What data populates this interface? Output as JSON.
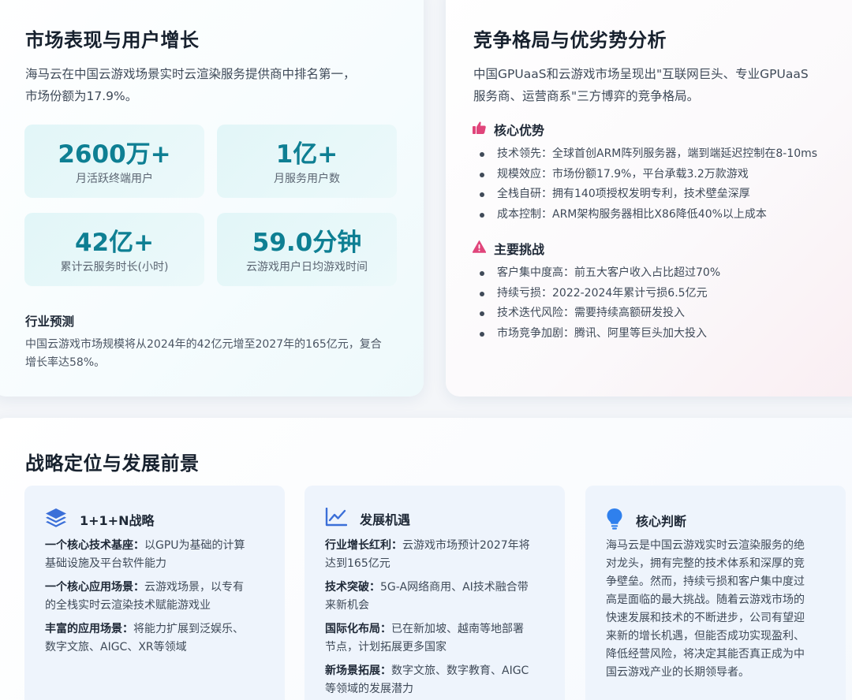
{
  "market": {
    "title": "市场表现与用户增长",
    "intro_line1": "海马云在中国云游戏场景实时云渲染服务提供商中排名第一，",
    "intro_line2": "市场份额为17.9%。",
    "stats": [
      {
        "value": "2600万+",
        "label": "月活跃终端用户"
      },
      {
        "value": "1亿+",
        "label": "月服务用户数"
      },
      {
        "value": "42亿+",
        "label": "累计云服务时长(小时)"
      },
      {
        "value": "59.0分钟",
        "label": "云游戏用户日均游戏时间"
      }
    ],
    "forecast_title": "行业预测",
    "forecast_line1": "中国云游戏市场规模将从2024年的42亿元增至2027年的165亿元，复合",
    "forecast_line2": "增长率达58%。"
  },
  "competition": {
    "title": "竞争格局与优劣势分析",
    "intro_line1": "中国GPUaaS和云游戏市场呈现出\"互联网巨头、专业GPUaaS",
    "intro_line2": "服务商、运营商系\"三方博弈的竞争格局。",
    "strengths_title": "核心优势",
    "strengths": [
      "技术领先：全球首创ARM阵列服务器，端到端延迟控制在8-10ms",
      "规模效应：市场份额17.9%，平台承载3.2万款游戏",
      "全栈自研：拥有140项授权发明专利，技术壁垒深厚",
      "成本控制：ARM架构服务器相比X86降低40%以上成本"
    ],
    "challenges_title": "主要挑战",
    "challenges": [
      "客户集中度高：前五大客户收入占比超过70%",
      "持续亏损：2022-2024年累计亏损6.5亿元",
      "技术迭代风险：需要持续高额研发投入",
      "市场竞争加剧：腾讯、阿里等巨头加大投入"
    ],
    "colors": {
      "strength_icon": "#e0457b",
      "challenge_icon": "#e0457b"
    }
  },
  "strategy": {
    "title": "战略定位与发展前景",
    "panels": [
      {
        "title": "1+1+N战略",
        "icon": "layers-icon",
        "items": [
          {
            "key": "一个核心技术基座：",
            "line1_rest": "以GPU为基础的计算",
            "line2": "基础设施及平台软件能力"
          },
          {
            "key": "一个核心应用场景：",
            "line1_rest": "云游戏场景，以专有",
            "line2": "的全栈实时云渲染技术赋能游戏业"
          },
          {
            "key": "丰富的应用场景：",
            "line1_rest": "将能力扩展到泛娱乐、",
            "line2": "数字文旅、AIGC、XR等领域"
          }
        ]
      },
      {
        "title": "发展机遇",
        "icon": "chart-line-icon",
        "items": [
          {
            "key": "行业增长红利：",
            "line1_rest": "云游戏市场预计2027年将",
            "line2": "达到165亿元"
          },
          {
            "key": "技术突破：",
            "line1_rest": "5G-A网络商用、AI技术融合带",
            "line2": "来新机会"
          },
          {
            "key": "国际化布局：",
            "line1_rest": "已在新加坡、越南等地部署",
            "line2": "节点，计划拓展更多国家"
          },
          {
            "key": "新场景拓展：",
            "line1_rest": "数字文旅、数字教育、AIGC",
            "line2": "等领域的发展潜力"
          }
        ]
      },
      {
        "title": "核心判断",
        "icon": "lightbulb-icon",
        "lines": [
          "海马云是中国云游戏实时云渲染服务的绝",
          "对龙头，拥有完整的技术体系和深厚的竞",
          "争壁垒。然而，持续亏损和客户集中度过",
          "高是面临的最大挑战。随着云游戏市场的",
          "快速发展和技术的不断进步，公司有望迎",
          "来新的增长机遇，但能否成功实现盈利、",
          "降低经营风险，将决定其能否真正成为中",
          "国云游戏产业的长期领导者。"
        ]
      }
    ],
    "colors": {
      "icon_blue": "#3b6fd8",
      "icon_bulb": "#2f80ed"
    }
  }
}
